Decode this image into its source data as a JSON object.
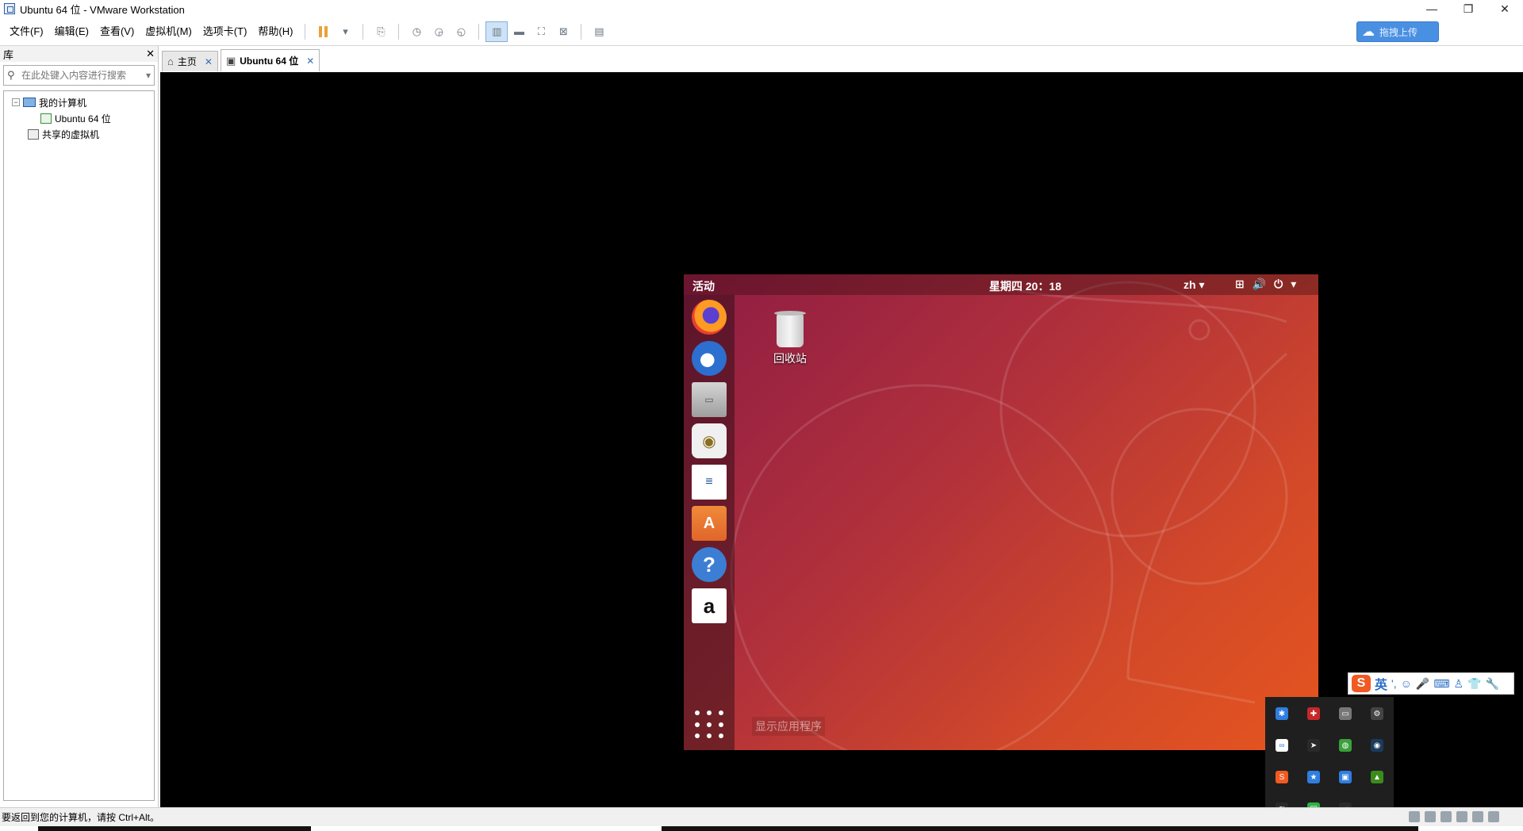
{
  "window": {
    "title": "Ubuntu 64 位 - VMware Workstation",
    "controls": [
      "—",
      "❐",
      "✕"
    ]
  },
  "menu": [
    "文件(F)",
    "编辑(E)",
    "查看(V)",
    "虚拟机(M)",
    "选项卡(T)",
    "帮助(H)"
  ],
  "toolbar": {
    "upload_label": "拖拽上传",
    "upload_icon": "cloud-icon"
  },
  "library": {
    "title": "库",
    "close": "✕",
    "search_placeholder": "在此处键入内容进行搜索",
    "tree": {
      "my_computer": "我的计算机",
      "vm": "Ubuntu 64 位",
      "shared": "共享的虚拟机"
    }
  },
  "tabs": [
    {
      "label": "主页",
      "close": "✕"
    },
    {
      "label": "Ubuntu 64 位",
      "close": "✕"
    }
  ],
  "guest": {
    "activities": "活动",
    "clock": "星期四 20：18",
    "lang": "zh ▾",
    "tray": [
      "⊞",
      "🔊",
      "⏻",
      "▾"
    ],
    "dock": [
      {
        "name": "firefox",
        "glyph": ""
      },
      {
        "name": "thunderbird",
        "glyph": ""
      },
      {
        "name": "files",
        "glyph": "▭"
      },
      {
        "name": "rhythmbox",
        "glyph": "◉"
      },
      {
        "name": "writer",
        "glyph": "≡"
      },
      {
        "name": "software",
        "glyph": "A"
      },
      {
        "name": "help",
        "glyph": "?"
      },
      {
        "name": "amazon",
        "glyph": "a"
      }
    ],
    "show_apps": "显示应用程序",
    "trash_label": "回收站"
  },
  "ime": {
    "logo": "S",
    "mode": "英",
    "punct": "',"
  },
  "status": {
    "message": "要返回到您的计算机，请按 Ctrl+Alt。"
  },
  "colors": {
    "accent": "#4a90e2",
    "ubuntu_orange": "#e6551f",
    "ubuntu_purple": "#8f1c44"
  }
}
